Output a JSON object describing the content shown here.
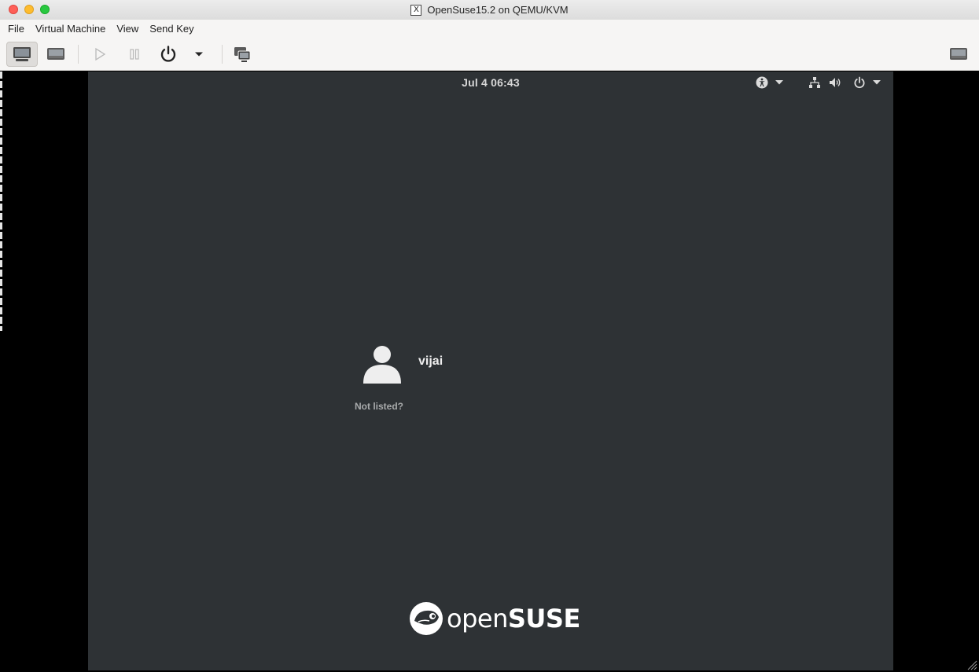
{
  "window": {
    "title": "OpenSuse15.2 on QEMU/KVM",
    "title_icon": "x11-icon"
  },
  "menubar": {
    "items": [
      "File",
      "Virtual Machine",
      "View",
      "Send Key"
    ]
  },
  "toolbar": {
    "buttons": [
      {
        "icon": "console-display-icon",
        "active": true
      },
      {
        "icon": "vm-details-icon",
        "active": false
      },
      {
        "icon": "play-icon",
        "active": false
      },
      {
        "icon": "pause-icon",
        "active": false
      },
      {
        "icon": "power-icon",
        "active": false
      },
      {
        "icon": "chevron-down-icon",
        "active": false
      },
      {
        "icon": "snapshots-icon",
        "active": false
      },
      {
        "icon": "fullscreen-icon",
        "active": false
      }
    ]
  },
  "guest": {
    "clock": "Jul 4  06:43",
    "top_icons": [
      "accessibility-icon",
      "network-icon",
      "volume-icon",
      "power-icon"
    ],
    "user": {
      "name": "vijai",
      "avatar_icon": "avatar-icon"
    },
    "not_listed": "Not listed?",
    "brand": {
      "prefix": "open",
      "suffix": "SUSE",
      "logo_icon": "opensuse-gecko-icon"
    },
    "colors": {
      "background": "#2e3235",
      "text": "#eeeeee",
      "muted": "#a8aaab"
    }
  }
}
